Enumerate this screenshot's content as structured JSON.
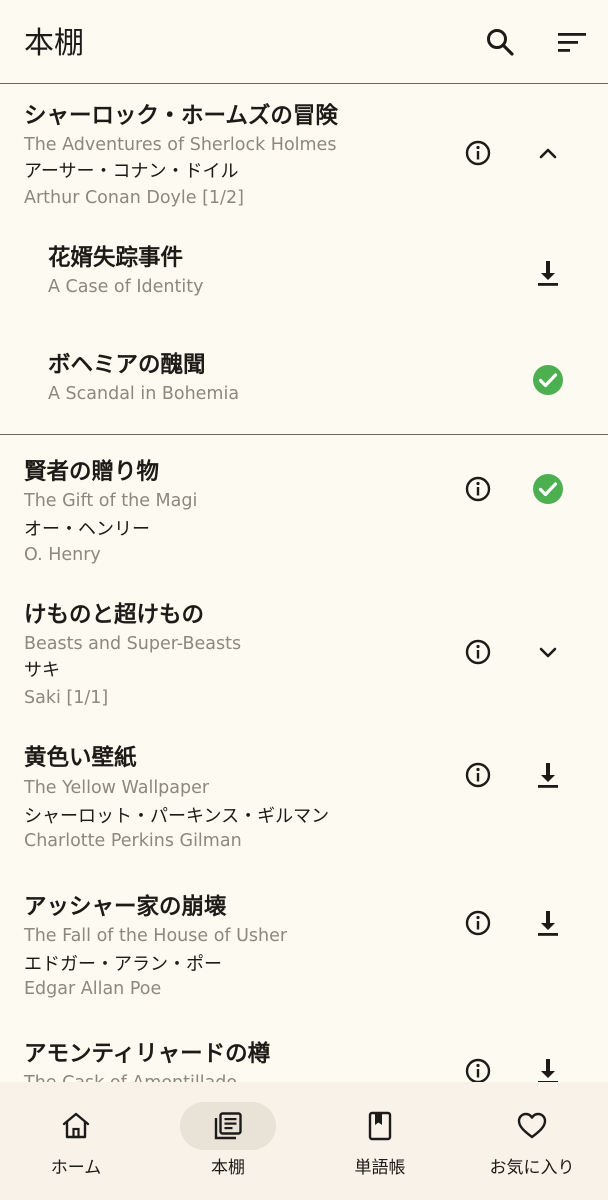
{
  "header": {
    "title": "本棚",
    "search_icon": "search-icon",
    "sort_icon": "sort-icon"
  },
  "books": [
    {
      "title_jp": "シャーロック・ホームズの冒険",
      "title_en": "The Adventures of Sherlock Holmes",
      "author_jp": "アーサー・コナン・ドイル",
      "author_en": "Arthur Conan Doyle  [1/2]",
      "action": "chevron-up-icon",
      "stories": [
        {
          "title_jp": "花婿失踪事件",
          "title_en": "A Case of Identity",
          "status": "download-icon"
        },
        {
          "title_jp": "ボヘミアの醜聞",
          "title_en": "A Scandal in Bohemia",
          "status": "check-circle-icon"
        }
      ]
    },
    {
      "title_jp": "賢者の贈り物",
      "title_en": "The Gift of the Magi",
      "author_jp": "オー・ヘンリー",
      "author_en": "O. Henry",
      "action": "check-circle-icon"
    },
    {
      "title_jp": "けものと超けもの",
      "title_en": "Beasts and Super-Beasts",
      "author_jp": "サキ",
      "author_en": "Saki  [1/1]",
      "action": "chevron-down-icon"
    },
    {
      "title_jp": "黄色い壁紙",
      "title_en": "The Yellow Wallpaper",
      "author_jp": "シャーロット・パーキンス・ギルマン",
      "author_en": "Charlotte Perkins Gilman",
      "action": "download-icon"
    },
    {
      "title_jp": "アッシャー家の崩壊",
      "title_en": "The Fall of the House of Usher",
      "author_jp": "エドガー・アラン・ポー",
      "author_en": "Edgar Allan Poe",
      "action": "download-icon"
    },
    {
      "title_jp": "アモンティリャードの樽",
      "title_en": "The Cask of Amontillado",
      "action": "download-icon"
    }
  ],
  "nav": [
    {
      "label": "ホーム",
      "icon": "home-icon",
      "active": false
    },
    {
      "label": "本棚",
      "icon": "library-icon",
      "active": true
    },
    {
      "label": "単語帳",
      "icon": "bookmark-book-icon",
      "active": false
    },
    {
      "label": "お気に入り",
      "icon": "heart-icon",
      "active": false
    }
  ],
  "colors": {
    "background": "#fdfaf2",
    "nav_background": "#f8f2e8",
    "active_pill": "#e9e2d6",
    "check_green": "#4caf50",
    "secondary_text": "#8c877f"
  }
}
